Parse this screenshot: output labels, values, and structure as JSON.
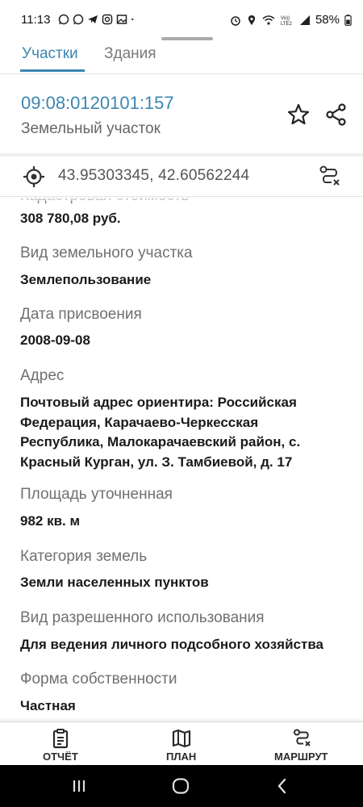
{
  "status_bar": {
    "time": "11:13",
    "battery": "58%",
    "left_icons": [
      "whatsapp-icon",
      "whatsapp-icon",
      "telegram-icon",
      "instagram-icon",
      "image-icon",
      "dot-icon"
    ],
    "right_icons": [
      "alarm-icon",
      "location-icon",
      "wifi-icon",
      "volte-icon",
      "signal-icon",
      "battery-icon"
    ],
    "volte_label": "Vo))\nLTE2"
  },
  "tabs": [
    {
      "label": "Участки",
      "active": true
    },
    {
      "label": "Здания",
      "active": false
    }
  ],
  "header": {
    "cadastral_number": "09:08:0120101:157",
    "object_type": "Земельный участок"
  },
  "coordinates": "43.95303345, 42.60562244",
  "fields": [
    {
      "label": "Кадастровая стоимость",
      "value": "308 780,08 руб."
    },
    {
      "label": "Вид земельного участка",
      "value": "Землепользование"
    },
    {
      "label": "Дата присвоения",
      "value": "2008-09-08"
    },
    {
      "label": "Адрес",
      "value_lines": [
        "Почтовый адрес ориентира: Российская",
        "Федерация, Карачаево-Черкесская",
        "Республика, Малокарачаевский район, с.",
        "Красный Курган, ул. З. Тамбиевой, д. 17"
      ]
    },
    {
      "label": "Площадь уточненная",
      "value": "982 кв. м"
    },
    {
      "label": "Категория земель",
      "value": "Земли населенных пунктов"
    },
    {
      "label": "Вид разрешенного использования",
      "value": "Для ведения личного подсобного хозяйства"
    },
    {
      "label": "Форма собственности",
      "value": "Частная"
    }
  ],
  "bottom_nav": [
    {
      "label": "ОТЧЁТ",
      "icon": "report-icon"
    },
    {
      "label": "ПЛАН",
      "icon": "map-icon"
    },
    {
      "label": "МАРШРУТ",
      "icon": "route-icon"
    }
  ],
  "colors": {
    "accent": "#3c86b0",
    "label_gray": "#707070",
    "value_dark": "#1a1a1a"
  }
}
